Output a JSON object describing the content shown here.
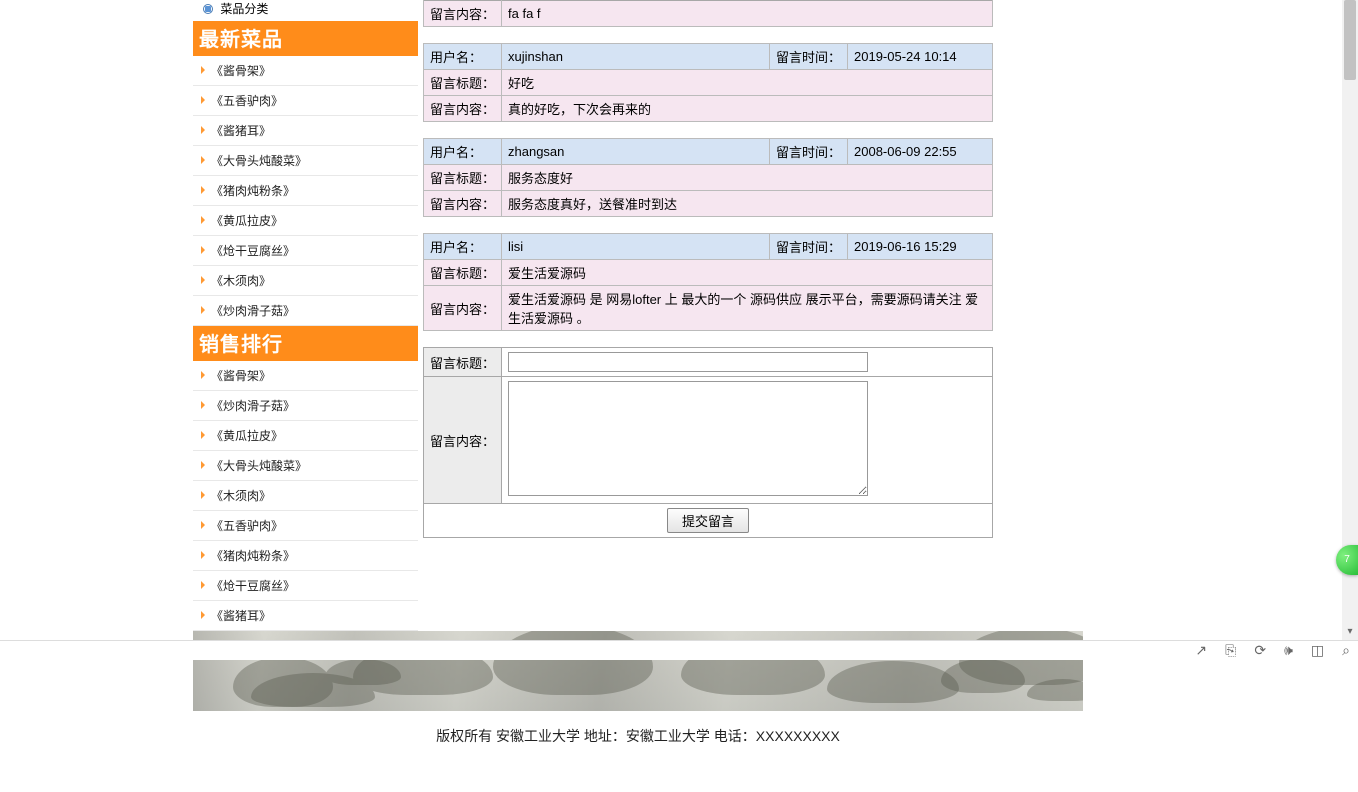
{
  "topCategory": "菜品分类",
  "sections": {
    "newDishes": {
      "title": "最新菜品",
      "items": [
        "《酱骨架》",
        "《五香驴肉》",
        "《酱猪耳》",
        "《大骨头炖酸菜》",
        "《猪肉炖粉条》",
        "《黄瓜拉皮》",
        "《炝干豆腐丝》",
        "《木须肉》",
        "《炒肉滑子菇》"
      ]
    },
    "salesRank": {
      "title": "销售排行",
      "items": [
        "《酱骨架》",
        "《炒肉滑子菇》",
        "《黄瓜拉皮》",
        "《大骨头炖酸菜》",
        "《木须肉》",
        "《五香驴肉》",
        "《猪肉炖粉条》",
        "《炝干豆腐丝》",
        "《酱猪耳》"
      ]
    }
  },
  "labels": {
    "user": "用户名：",
    "time": "留言时间：",
    "title": "留言标题：",
    "content": "留言内容：",
    "submit": "提交留言"
  },
  "messages": [
    {
      "content_only": true,
      "content": "fa fa f"
    },
    {
      "user": "xujinshan",
      "time": "2019-05-24 10:14",
      "title": "好吃",
      "content": "真的好吃，下次会再来的"
    },
    {
      "user": "zhangsan",
      "time": "2008-06-09 22:55",
      "title": "服务态度好",
      "content": "服务态度真好，送餐准时到达"
    },
    {
      "user": "lisi",
      "time": "2019-06-16 15:29",
      "title": "爱生活爱源码",
      "content": "爱生活爱源码 是 网易lofter 上 最大的一个 源码供应 展示平台，需要源码请关注 爱生活爱源码 。"
    }
  ],
  "copyright": "版权所有 安徽工业大学 地址：安徽工业大学 电话：XXXXXXXXX",
  "badge": "7",
  "toolbarIcons": [
    "↗",
    "⎘",
    "⟳",
    "🕪",
    "◫",
    "⌕"
  ]
}
